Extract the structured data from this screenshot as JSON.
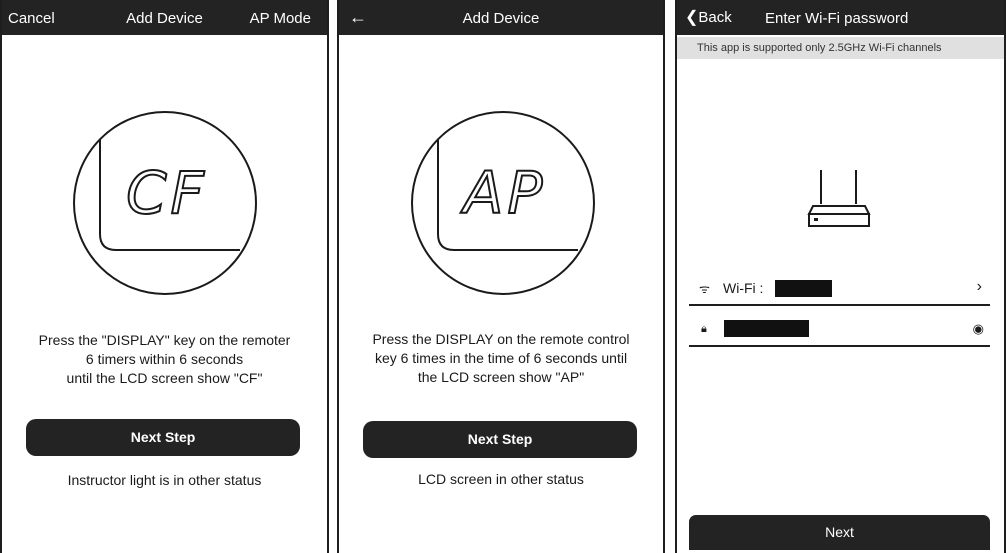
{
  "screen1": {
    "cancel_label": "Cancel",
    "title": "Add Device",
    "mode_label": "AP Mode",
    "lcd_code": "CF",
    "instructions": [
      "Press the \"DISPLAY\" key on the remoter",
      "6 timers within 6 seconds",
      "until the LCD screen show \"CF\""
    ],
    "next_label": "Next Step",
    "alt_status": "Instructor light is in other status"
  },
  "screen2": {
    "back_icon": "arrow-left-icon",
    "title": "Add Device",
    "lcd_code": "AP",
    "instructions": [
      "Press the DISPLAY on the remote control",
      "key 6 times in the time of 6 seconds until",
      "the LCD screen show \"AP\""
    ],
    "next_label": "Next Step",
    "alt_status": "LCD screen in other status"
  },
  "screen3": {
    "back_label": "Back",
    "title": "Enter Wi-Fi password",
    "notice": "This app is supported only 2.5GHz Wi-Fi channels",
    "wifi_label": "Wi-Fi :",
    "next_label": "Next"
  },
  "colors": {
    "bar": "#232323",
    "notice_bg": "#e0e0e0",
    "ink": "#1a1a1a"
  }
}
